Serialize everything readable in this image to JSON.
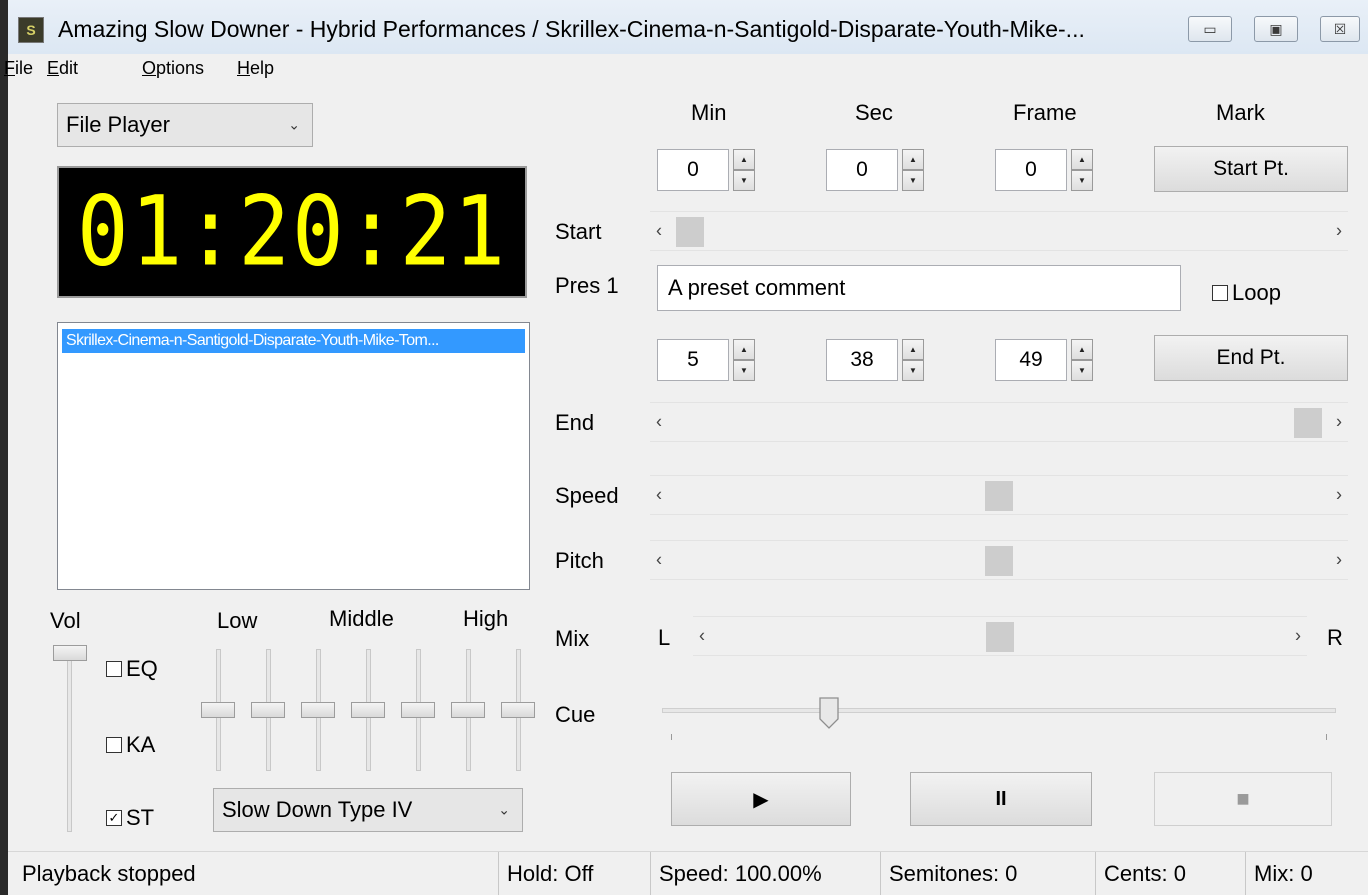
{
  "window": {
    "title": "Amazing Slow Downer - Hybrid Performances / Skrillex-Cinema-n-Santigold-Disparate-Youth-Mike-...",
    "minimize_glyph": "▭",
    "maximize_glyph": "▣",
    "close_glyph": "☒"
  },
  "menu": [
    {
      "underline": "F",
      "rest": "ile"
    },
    {
      "underline": "E",
      "rest": "dit"
    },
    {
      "underline": "O",
      "rest": "ptions"
    },
    {
      "underline": "H",
      "rest": "elp"
    }
  ],
  "player_mode": "File Player",
  "time_display": "01:20:21",
  "file_list": [
    "Skrillex-Cinema-n-Santigold-Disparate-Youth-Mike-Tom..."
  ],
  "columns": {
    "min": "Min",
    "sec": "Sec",
    "frame": "Frame",
    "mark": "Mark"
  },
  "start": {
    "min": "0",
    "sec": "0",
    "frame": "0",
    "button": "Start Pt.",
    "label": "Start"
  },
  "preset": {
    "label": "Pres 1",
    "comment": "A preset comment",
    "loop_label": "Loop",
    "loop_checked": false
  },
  "end": {
    "min": "5",
    "sec": "38",
    "frame": "49",
    "button": "End Pt.",
    "label": "End"
  },
  "sliders": {
    "speed_label": "Speed",
    "pitch_label": "Pitch",
    "mix_label": "Mix",
    "mix_left": "L",
    "mix_right": "R",
    "cue_label": "Cue",
    "start_level": 0.0,
    "end_level": 1.0,
    "speed_level": 0.5,
    "pitch_level": 0.5,
    "mix_level": 0.5,
    "cue_level": 0.24
  },
  "eq": {
    "vol_label": "Vol",
    "low_label": "Low",
    "middle_label": "Middle",
    "high_label": "High",
    "eq_label": "EQ",
    "ka_label": "KA",
    "st_label": "ST",
    "eq_checked": false,
    "ka_checked": false,
    "st_checked": true,
    "slow_down_type": "Slow Down Type IV"
  },
  "transport": {
    "play_icon": "▶",
    "pause_icon": "II",
    "stop_icon": "■"
  },
  "statusbar": {
    "message": "Playback stopped",
    "hold": "Hold: Off",
    "speed": "Speed: 100.00%",
    "semitones": "Semitones: 0",
    "cents": "Cents: 0",
    "mix": "Mix:  0"
  }
}
